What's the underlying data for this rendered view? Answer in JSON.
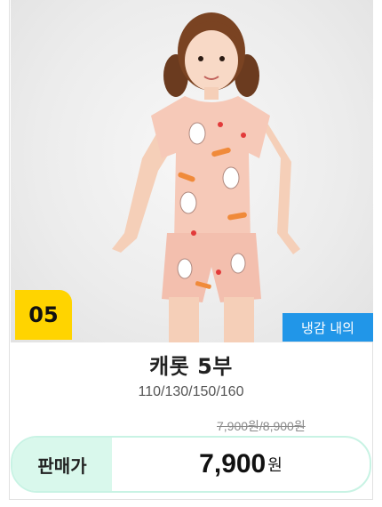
{
  "product": {
    "number": "05",
    "tag": "냉감 내의",
    "name": "캐롯 5부",
    "sizes": "110/130/150/160",
    "old_price": "7,900원/8,900원",
    "price_label": "판매가",
    "price": "7,900",
    "price_unit": "원"
  },
  "colors": {
    "badge": "#ffd400",
    "tag": "#2196e8",
    "price_accent": "#d9f8ec",
    "pajama": "#f6c9b8"
  }
}
